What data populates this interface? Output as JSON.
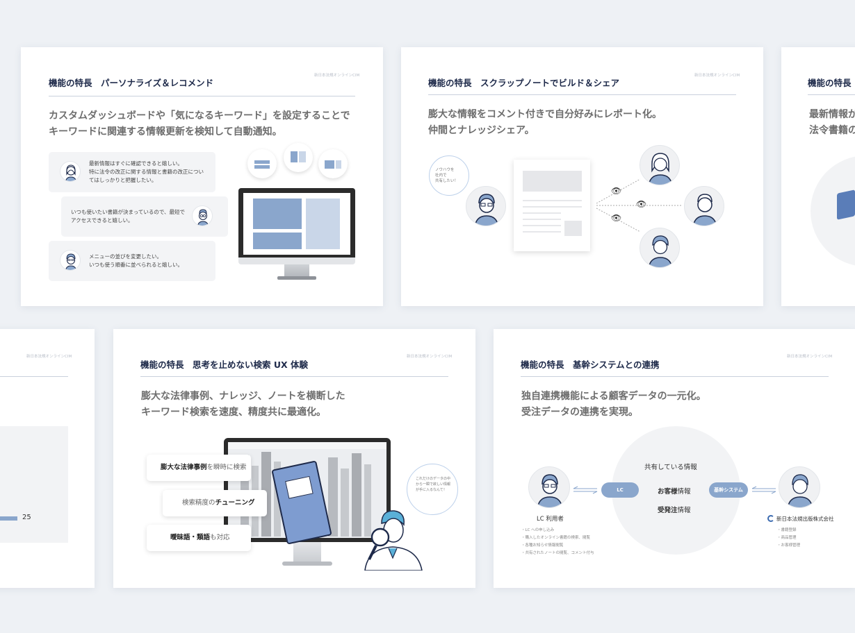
{
  "brand": "新日本法規オンラインCIM",
  "slide1": {
    "title": "機能の特長　パーソナライズ＆レコメンド",
    "lead": [
      "カスタムダッシュボードや「気になるキーワード」を設定することで",
      "キーワードに関連する情報更新を検知して自動通知。"
    ],
    "bubbles": [
      [
        "最新情報はすぐに確認できると嬉しい。",
        "特に法令の改正に関する情報と書籍の改正につい",
        "てはしっかりと把握したい。"
      ],
      [
        "いつも使いたい書籍が決まっているので、最短で",
        "アクセスできると嬉しい。"
      ],
      [
        "メニューの並びを変更したい。",
        "いつも使う順番に並べられると嬉しい。"
      ]
    ]
  },
  "slide2": {
    "title": "機能の特長　スクラップノートでビルド＆シェア",
    "lead": [
      "膨大な情報をコメント付きで自分好みにレポート化。",
      "仲間とナレッジシェア。"
    ],
    "speech": [
      "ノウハウを",
      "社内で",
      "共有したい！"
    ]
  },
  "slide3": {
    "title": "機能の特長",
    "lead": [
      "最新情報が",
      "法令書籍の"
    ]
  },
  "slide4": {
    "value": "25"
  },
  "slide5": {
    "title": "機能の特長　思考を止めない検索 UX 体験",
    "lead": [
      "膨大な法律事例、ナレッジ、ノートを横断した",
      "キーワード検索を速度、精度共に最適化。"
    ],
    "pills": [
      {
        "bold": "膨大な法律事例",
        "rest": "を瞬時に検索"
      },
      {
        "pre": "検索精度の",
        "bold": "チューニング"
      },
      {
        "bold": "曖昧語・類語",
        "rest": "も対応"
      }
    ],
    "speech": [
      "これだけのデータの中",
      "から一瞬で欲しい情報",
      "が手に入るなんて！"
    ]
  },
  "slide6": {
    "title": "機能の特長　基幹システムとの連携",
    "lead": [
      "独自連携機能による顧客データの一元化。",
      "受注データの連携を実現。"
    ],
    "shared_title": "共有している情報",
    "shared_items": [
      {
        "bold": "お客様",
        "rest": "情報"
      },
      {
        "bold": "受発注",
        "rest": "情報"
      }
    ],
    "chip_left": "LC",
    "chip_right": "基幹システム",
    "user_label": "LC 利用者",
    "company_label": "新日本法規出版株式会社",
    "user_items": [
      "・LC への申し込み",
      "・購入したオンライン書籍の検索、閲覧",
      "・各種お知らせ情報閲覧",
      "・共有されたノートの閲覧、コメント付与"
    ],
    "company_items": [
      "・書籍登録",
      "・商品管理",
      "・お客様管理"
    ]
  },
  "colors": {
    "accent": "#8aa6cc",
    "title": "#1e2a4a"
  }
}
